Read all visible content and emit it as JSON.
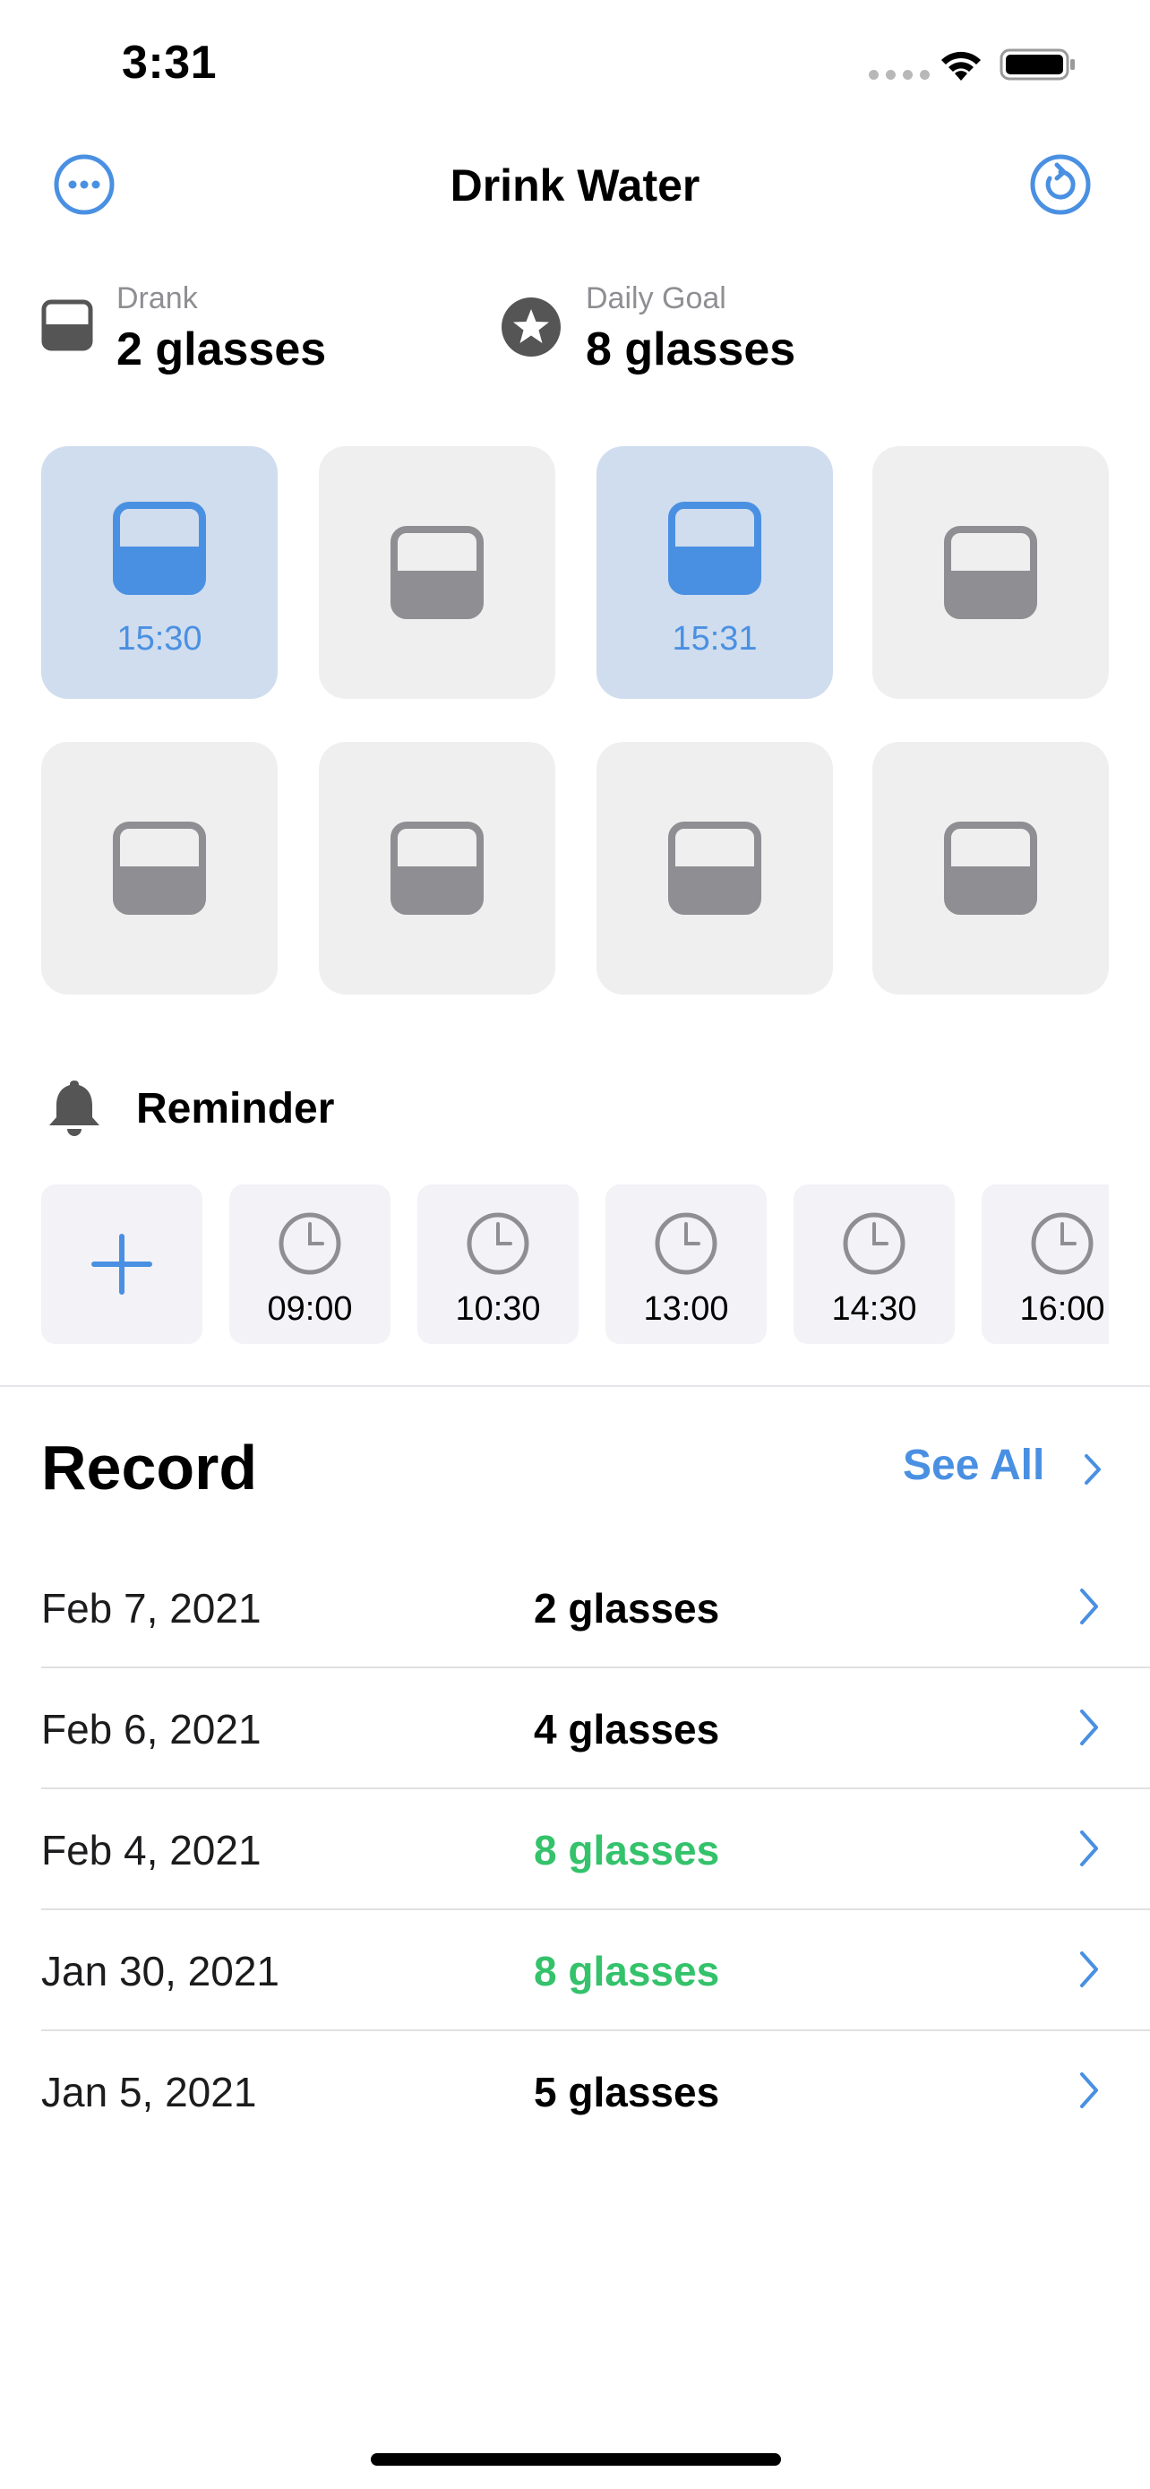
{
  "status_bar": {
    "time": "3:31"
  },
  "nav": {
    "title": "Drink Water"
  },
  "summary": {
    "drank_label": "Drank",
    "drank_value": "2 glasses",
    "goal_label": "Daily Goal",
    "goal_value": "8 glasses"
  },
  "glasses": [
    {
      "filled": true,
      "time": "15:30"
    },
    {
      "filled": false,
      "time": ""
    },
    {
      "filled": true,
      "time": "15:31"
    },
    {
      "filled": false,
      "time": ""
    },
    {
      "filled": false,
      "time": ""
    },
    {
      "filled": false,
      "time": ""
    },
    {
      "filled": false,
      "time": ""
    },
    {
      "filled": false,
      "time": ""
    }
  ],
  "reminder": {
    "title": "Reminder",
    "times": [
      "09:00",
      "10:30",
      "13:00",
      "14:30",
      "16:00"
    ]
  },
  "record": {
    "title": "Record",
    "see_all_label": "See All",
    "rows": [
      {
        "date": "Feb 7, 2021",
        "amount": "2 glasses",
        "goal_met": false
      },
      {
        "date": "Feb 6, 2021",
        "amount": "4 glasses",
        "goal_met": false
      },
      {
        "date": "Feb 4, 2021",
        "amount": "8 glasses",
        "goal_met": true
      },
      {
        "date": "Jan 30, 2021",
        "amount": "8 glasses",
        "goal_met": true
      },
      {
        "date": "Jan 5, 2021",
        "amount": "5 glasses",
        "goal_met": false
      }
    ]
  },
  "colors": {
    "accent": "#4a90e2",
    "goal_met": "#34c26b",
    "tile_filled_bg": "#d0ddee",
    "tile_empty_bg": "#efefef",
    "glass_empty": "#8e8e93",
    "icon_dark": "#555555"
  }
}
